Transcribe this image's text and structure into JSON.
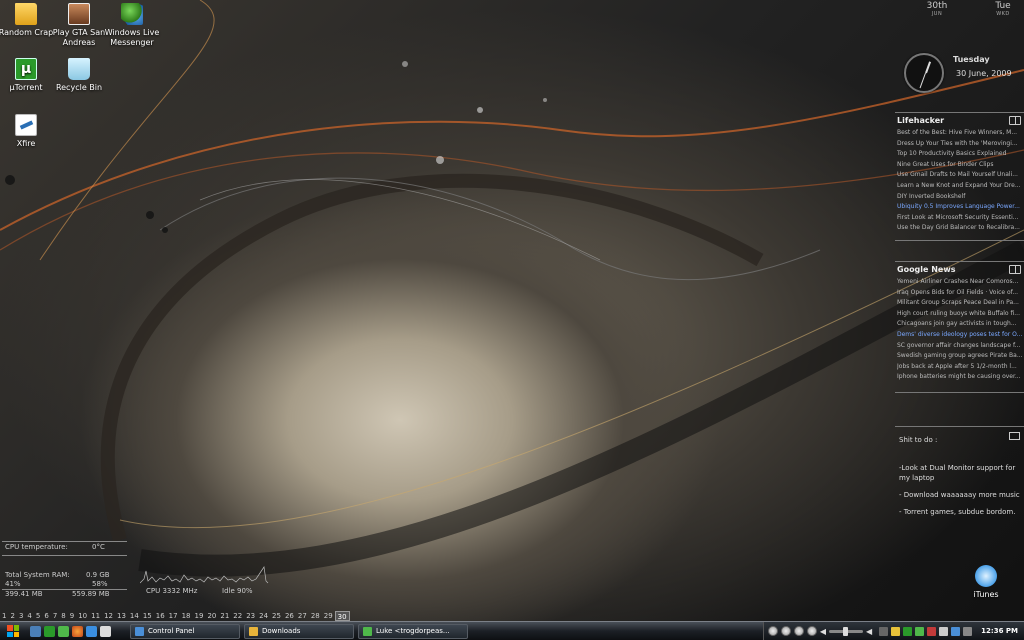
{
  "desktop_icons": [
    {
      "name": "random-crap",
      "label": "Random Crap",
      "icon": "folder-icon"
    },
    {
      "name": "gta-san-andreas",
      "label": "Play GTA San Andreas",
      "icon": "game-shortcut-icon"
    },
    {
      "name": "windows-live-messenger",
      "label": "Windows Live Messenger",
      "icon": "messenger-icon"
    },
    {
      "name": "utorrent",
      "label": "µTorrent",
      "icon": "utorrent-icon"
    },
    {
      "name": "recycle-bin",
      "label": "Recycle Bin",
      "icon": "recycle-bin-icon"
    },
    {
      "name": "xfire",
      "label": "Xfire",
      "icon": "xfire-icon"
    },
    {
      "name": "itunes",
      "label": "iTunes",
      "icon": "itunes-icon"
    }
  ],
  "sidebar": {
    "date_day": "30th",
    "date_month": "JUN",
    "date_weekday": "Tue",
    "date_weekday_short": "WKD",
    "clock_weekday": "Tuesday",
    "clock_date": "30 June, 2009",
    "lifehacker": {
      "title": "Lifehacker",
      "items": [
        "Best of the Best: Hive Five Winners, M...",
        "Dress Up Your Ties with the 'Merovingi...",
        "Top 10 Productivity Basics Explained",
        "Nine Great Uses for Binder Clips",
        "Use Gmail Drafts to Mail Yourself Unali...",
        "Learn a New Knot and Expand Your Dre...",
        "DIY Inverted Bookshelf",
        "Ubiquity 0.5 Improves Language Power...",
        "First Look at Microsoft Security Essenti...",
        "Use the Day Grid Balancer to Recalibra..."
      ],
      "highlighted_index": 7
    },
    "google_news": {
      "title": "Google News",
      "items": [
        "Yemeni Airliner Crashes Near Comoros...",
        "Iraq Opens Bids for Oil Fields · Voice of...",
        "Militant Group Scraps Peace Deal in Pa...",
        "High court ruling buoys white Buffalo fi...",
        "Chicagoans join gay activists in tough...",
        "Dems' diverse ideology poses test for O...",
        "SC governor affair changes landscape f...",
        "Swedish gaming group agrees Pirate Ba...",
        "Jobs back at Apple after 5 1/2-month l...",
        "Iphone batteries might be causing over..."
      ],
      "highlighted_index": 5
    },
    "notes": {
      "title": "Shit to do :",
      "lines": [
        "-Look at Dual Monitor support for my laptop",
        "- Download waaaaaay more music",
        "- Torrent games, subdue bordom."
      ]
    }
  },
  "system_stats": {
    "cpu_temp_label": "CPU temperature:",
    "cpu_temp_value": "0°C",
    "ram_label": "Total System RAM:",
    "ram_value": "0.9 GB",
    "ram_pct_left": "41%",
    "ram_pct_right": "58%",
    "ram_used": "399.41 MB",
    "ram_free": "559.89 MB",
    "cpu_label": "CPU 3332 MHz",
    "idle_label": "Idle 90%"
  },
  "pager": {
    "pages": [
      "1",
      "2",
      "3",
      "4",
      "5",
      "6",
      "7",
      "8",
      "9",
      "10",
      "11",
      "12",
      "13",
      "14",
      "15",
      "16",
      "17",
      "18",
      "19",
      "20",
      "21",
      "22",
      "23",
      "24",
      "25",
      "26",
      "27",
      "28",
      "29",
      "30"
    ],
    "active": "30"
  },
  "taskbar": {
    "tasks": [
      {
        "label": "Control Panel",
        "icon": "control-panel-icon",
        "color": "#4a8fd8"
      },
      {
        "label": "Downloads",
        "icon": "folder-icon",
        "color": "#e8b43a"
      },
      {
        "label": "Luke <trogdorpeas...",
        "icon": "messenger-icon",
        "color": "#4fb84a"
      }
    ],
    "clock": "12:36 PM"
  }
}
